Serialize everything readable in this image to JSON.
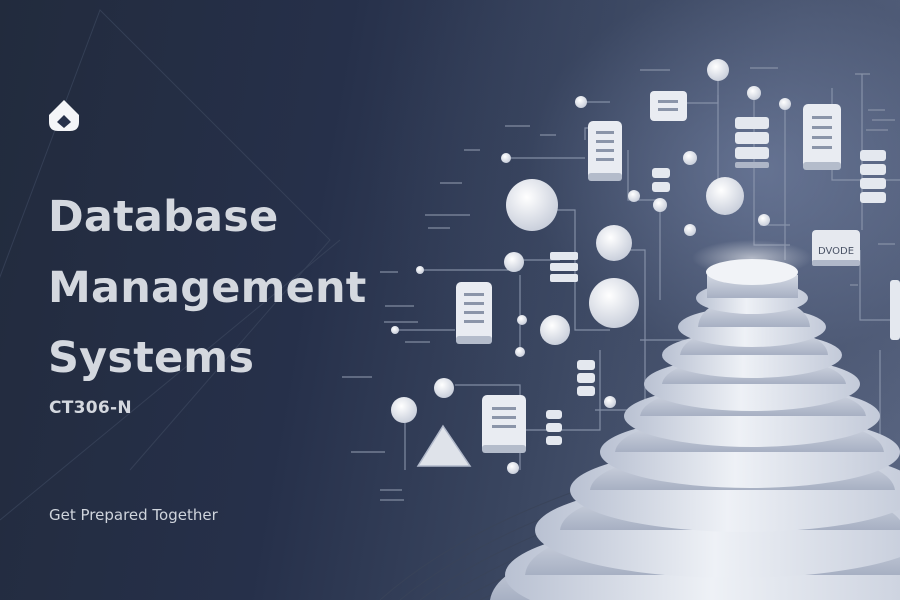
{
  "brand": {
    "logo_icon": "brand-logo-icon"
  },
  "hero": {
    "title_lines": [
      "Database",
      "Management",
      "Systems"
    ],
    "course_code": "CT306-N",
    "tagline": "Get Prepared Together"
  },
  "illustration": {
    "node_label": "DVODE",
    "description_icon": "database-stack-illustration"
  },
  "colors": {
    "background_dark": "#1f2636",
    "title_text": "#d4d8df",
    "accent_node": "#e6e9ef"
  }
}
